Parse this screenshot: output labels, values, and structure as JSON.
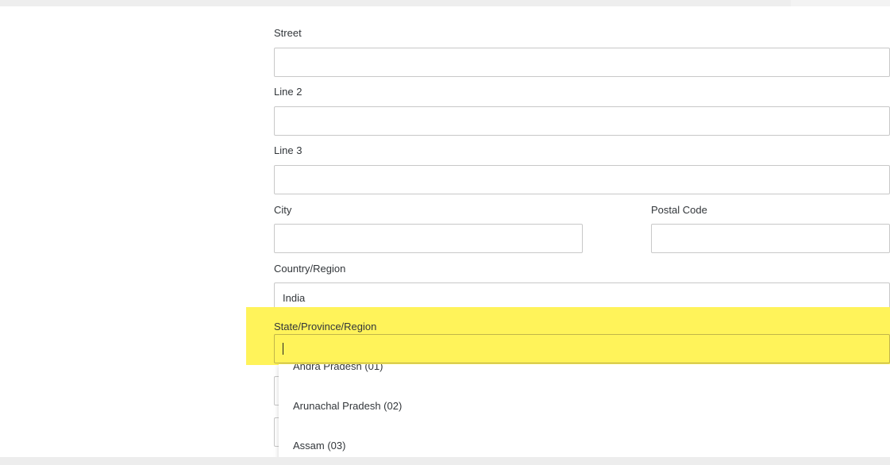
{
  "form": {
    "street": {
      "label": "Street",
      "value": ""
    },
    "line2": {
      "label": "Line 2",
      "value": ""
    },
    "line3": {
      "label": "Line 3",
      "value": ""
    },
    "city": {
      "label": "City",
      "value": ""
    },
    "postal_code": {
      "label": "Postal Code",
      "value": ""
    },
    "country": {
      "label": "Country/Region",
      "value": "India"
    },
    "state": {
      "label": "State/Province/Region",
      "value": ""
    }
  },
  "state_dropdown": {
    "options": [
      "Andra Pradesh (01)",
      "Arunachal Pradesh (02)",
      "Assam (03)"
    ]
  },
  "colors": {
    "highlight": "#fff35a",
    "field_border": "#c8c8c8",
    "text": "#32363a"
  }
}
